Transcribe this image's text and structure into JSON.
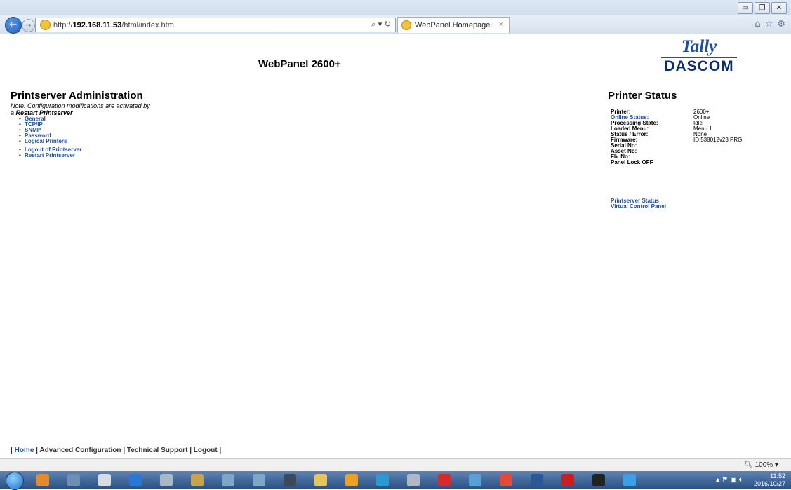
{
  "browser": {
    "url_prefix": "http://",
    "url_host": "192.168.11.53",
    "url_path": "/html/index.htm",
    "addr_tools": "⌕ ▾ ↻",
    "tab_title": "WebPanel Homepage",
    "tab_close": "×",
    "win_minimize": "▭",
    "win_restore": "❐",
    "win_close": "✕",
    "back": "←",
    "forward": "→",
    "right_icons": [
      "⌂",
      "☆",
      "⚙"
    ]
  },
  "page": {
    "title": "WebPanel 2600+",
    "logo_top": "Tally",
    "logo_bottom": "DASCOM"
  },
  "admin": {
    "heading": "Printserver Administration",
    "note_line1": "Note: Configuration modifications are activated by",
    "note_prefix": "a ",
    "note_bold": "Restart Printserver",
    "menu1": [
      "General",
      "TCP/IP",
      "SNMP",
      "Password",
      "Logical Printers"
    ],
    "menu2": [
      "Logout of Printserver",
      "Restart Printserver"
    ]
  },
  "status": {
    "heading": "Printer Status",
    "rows": [
      {
        "label": "Printer:",
        "value": "2600+"
      },
      {
        "label": "Online Status:",
        "value": "Online"
      },
      {
        "label": "Processing State:",
        "value": "Idle"
      },
      {
        "label": "Loaded Menu:",
        "value": "Menu 1"
      },
      {
        "label": "Status / Error:",
        "value": "None"
      },
      {
        "label": "Firmware:",
        "value": "ID:538012v23 PRG"
      },
      {
        "label": "Serial No:",
        "value": ""
      },
      {
        "label": "Asset No:",
        "value": ""
      },
      {
        "label": "Fb. No:",
        "value": ""
      },
      {
        "label": "Panel Lock OFF",
        "value": ""
      }
    ],
    "link_printserver_status": "Printserver Status",
    "link_virtual_panel": "Virtual Control Panel"
  },
  "footer": {
    "sep": "|",
    "home": "Home",
    "advanced": "Advanced Configuration",
    "support": "Technical Support",
    "logout": "Logout"
  },
  "statusbar": {
    "zoom": "100%",
    "zoom_icon": "🔍︎",
    "zoom_arrow": "▾"
  },
  "taskbar": {
    "time": "11:52",
    "date": "2016/10/27",
    "tray_icons": "▴ ⚑ ▣ 🔈︎"
  },
  "colors": {
    "link": "#1e4f9c",
    "taskbar": "#2a4f80"
  }
}
